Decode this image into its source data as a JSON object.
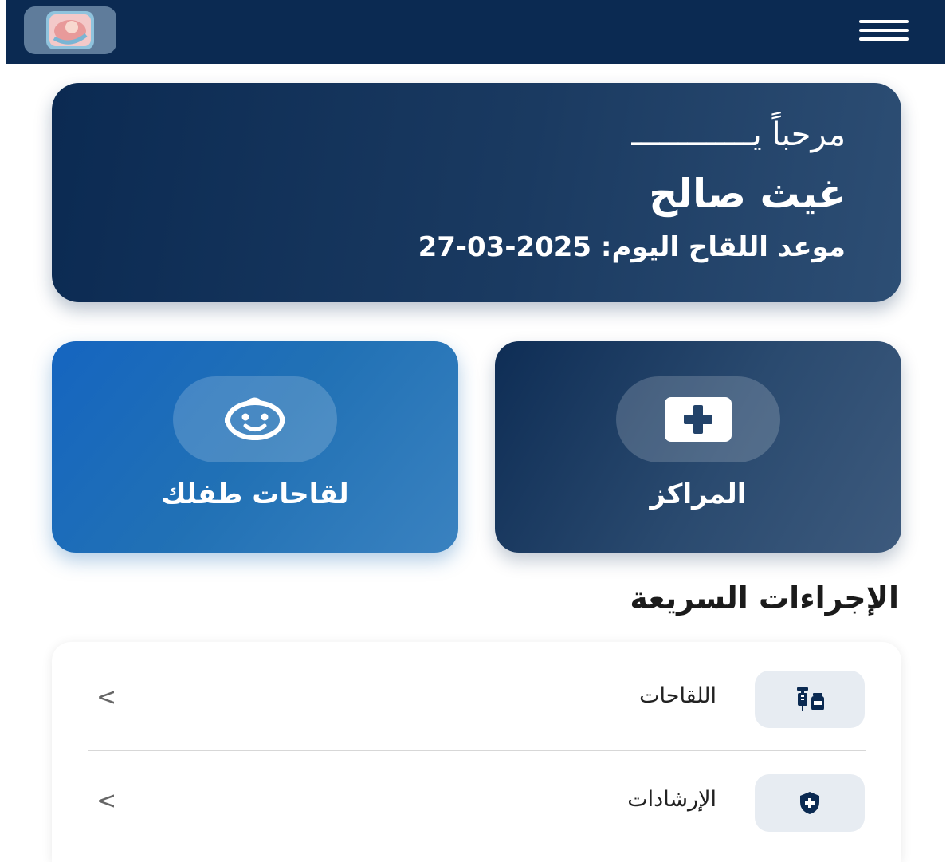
{
  "header": {
    "logo_icon": "baby-app-logo-icon",
    "menu_icon": "hamburger-menu-icon",
    "background_color": "#0b2a52"
  },
  "welcome": {
    "greeting": "مرحباً يـــــــــــــ",
    "name": "غيث صالح",
    "vaccine_label": "موعد اللقاح اليوم:",
    "vaccine_date": "27-03-2025"
  },
  "tiles": [
    {
      "label": "المراكز",
      "icon": "medical-cross-icon"
    },
    {
      "label": "لقاحات طفلك",
      "icon": "baby-face-icon"
    }
  ],
  "quick_actions": {
    "title": "الإجراءات السريعة",
    "items": [
      {
        "label": "اللقاحات",
        "icon": "syringe-vial-icon",
        "chevron": "<"
      },
      {
        "label": "الإرشادات",
        "icon": "shield-plus-icon",
        "chevron": "<"
      }
    ]
  },
  "colors": {
    "navy": "#0b2a52",
    "blue": "#1e6fb5",
    "icon_box": "#e7ecf2"
  }
}
